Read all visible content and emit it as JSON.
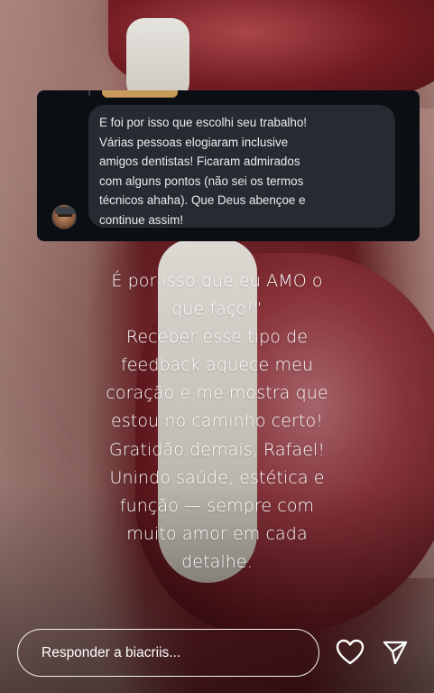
{
  "story": {
    "background": {
      "description_icon": "smile-photo"
    },
    "dm_screenshot": {
      "message_lines": [
        "E foi por isso que escolhi seu trabalho!",
        "Várias pessoas elogiaram inclusive",
        "amigos dentistas! Ficaram admirados",
        "com alguns pontos (não sei os termos",
        "técnicos ahaha). Que Deus abençoe e",
        "continue assim!"
      ],
      "avatar_icon": "user-avatar",
      "bubble_color": "#262b31",
      "card_color": "#0b0f14"
    },
    "caption_lines": [
      "É por isso que eu AMO o",
      "que faço!”",
      "Receber esse tipo de",
      "feedback aquece meu",
      "coração e me mostra que",
      "estou no caminho certo!",
      "Gratidão demais, Rafael!",
      "Unindo saúde, estética e",
      "função — sempre com",
      "muito amor em cada",
      "detalhe."
    ]
  },
  "reply_bar": {
    "placeholder": "Responder a biacriis...",
    "like_icon": "heart-icon",
    "send_icon": "send-icon"
  }
}
